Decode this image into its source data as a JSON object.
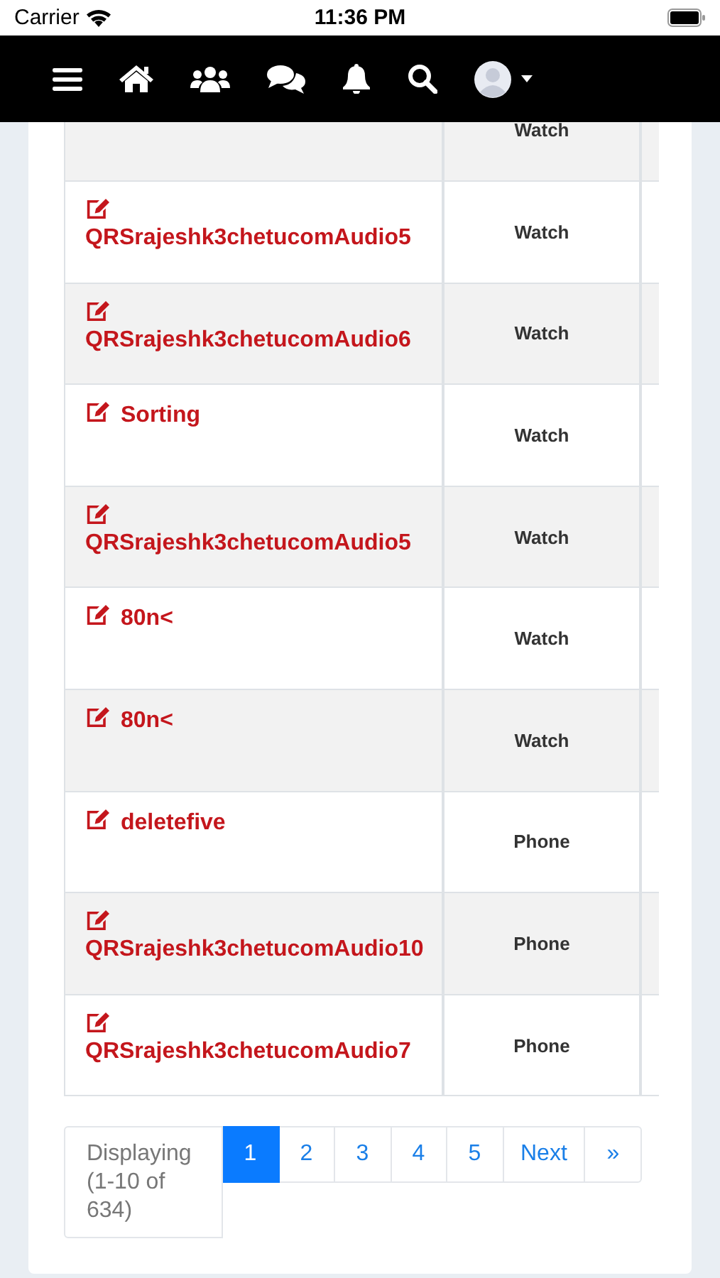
{
  "status_bar": {
    "carrier": "Carrier",
    "time": "11:36 PM"
  },
  "table": {
    "rows": [
      {
        "device": "Watch"
      },
      {
        "name": "QRSrajeshk3chetucomAudio5",
        "device": "Watch"
      },
      {
        "name": "QRSrajeshk3chetucomAudio6",
        "device": "Watch"
      },
      {
        "name": "Sorting",
        "device": "Watch"
      },
      {
        "name": "QRSrajeshk3chetucomAudio5",
        "device": "Watch"
      },
      {
        "name": "80n<",
        "device": "Watch"
      },
      {
        "name": "80n<",
        "device": "Watch"
      },
      {
        "name": "deletefive",
        "device": "Phone"
      },
      {
        "name": "QRSrajeshk3chetucomAudio10",
        "device": "Phone"
      },
      {
        "name": "QRSrajeshk3chetucomAudio7",
        "device": "Phone"
      }
    ]
  },
  "pagination": {
    "info": "Displaying (1-10 of 634)",
    "pages": [
      {
        "label": "1",
        "selected": true
      },
      {
        "label": "2",
        "selected": false
      },
      {
        "label": "3",
        "selected": false
      },
      {
        "label": "4",
        "selected": false
      },
      {
        "label": "5",
        "selected": false
      },
      {
        "label": "Next",
        "selected": false
      },
      {
        "label": "»",
        "selected": false
      }
    ]
  }
}
